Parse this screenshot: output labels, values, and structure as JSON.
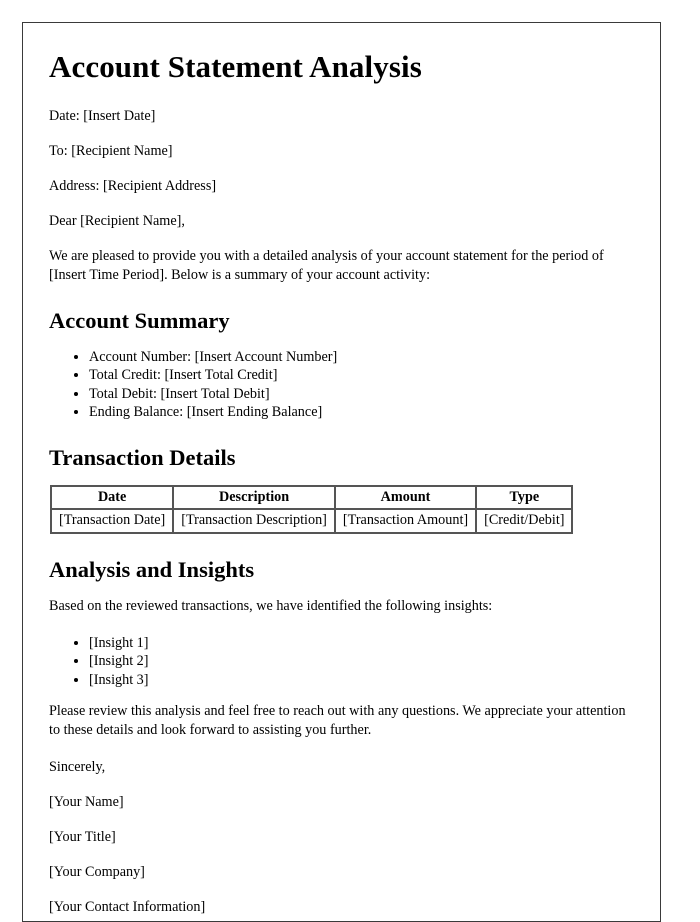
{
  "document": {
    "title": "Account Statement Analysis",
    "header_lines": [
      "Date: [Insert Date]",
      "To: [Recipient Name]",
      "Address: [Recipient Address]",
      "Dear [Recipient Name],"
    ],
    "intro_paragraph": "We are pleased to provide you with a detailed analysis of your account statement for the period of [Insert Time Period]. Below is a summary of your account activity:",
    "account_summary": {
      "heading": "Account Summary",
      "items": [
        "Account Number: [Insert Account Number]",
        "Total Credit: [Insert Total Credit]",
        "Total Debit: [Insert Total Debit]",
        "Ending Balance: [Insert Ending Balance]"
      ]
    },
    "transaction_details": {
      "heading": "Transaction Details",
      "columns": [
        "Date",
        "Description",
        "Amount",
        "Type"
      ],
      "rows": [
        [
          "[Transaction Date]",
          "[Transaction Description]",
          "[Transaction Amount]",
          "[Credit/Debit]"
        ]
      ]
    },
    "analysis": {
      "heading": "Analysis and Insights",
      "lead_paragraph": "Based on the reviewed transactions, we have identified the following insights:",
      "insights": [
        "[Insight 1]",
        "[Insight 2]",
        "[Insight 3]"
      ],
      "closing_paragraph": "Please review this analysis and feel free to reach out with any questions. We appreciate your attention to these details and look forward to assisting you further."
    },
    "signature": {
      "closing": "Sincerely,",
      "lines": [
        "[Your Name]",
        "[Your Title]",
        "[Your Company]",
        "[Your Contact Information]"
      ]
    }
  }
}
